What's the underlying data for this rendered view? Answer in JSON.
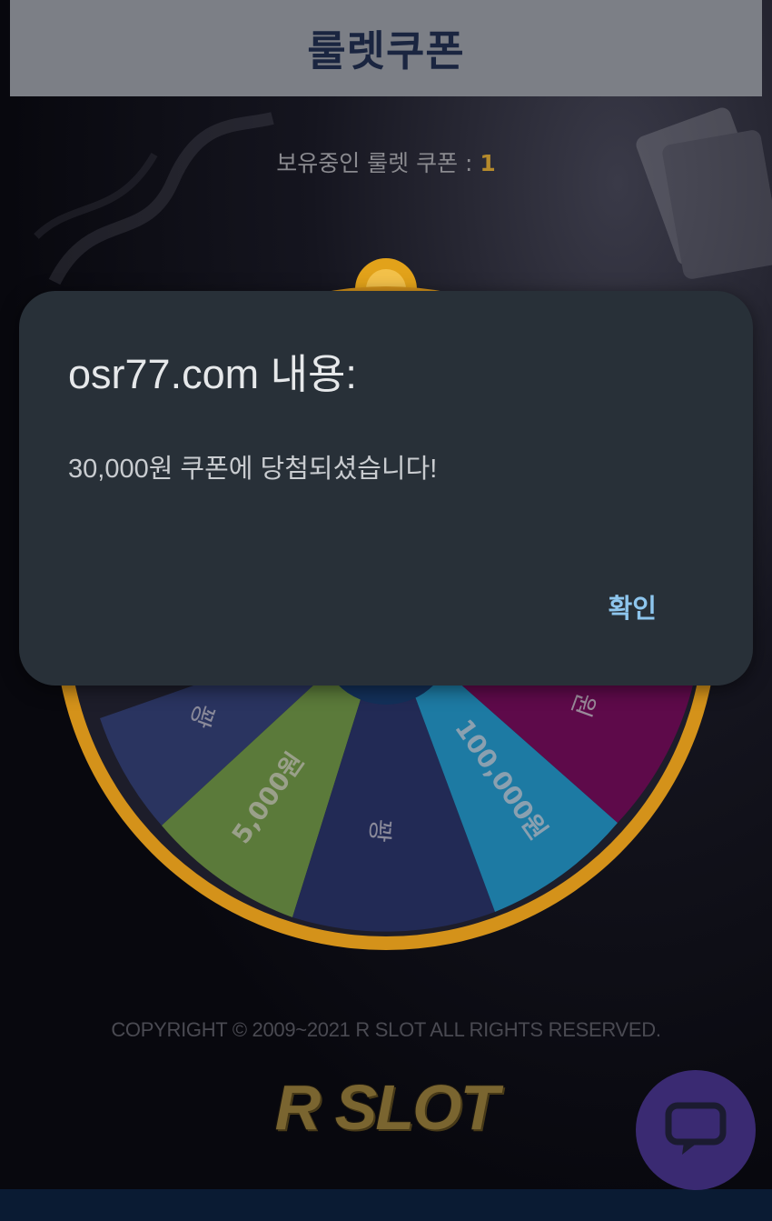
{
  "header": {
    "title": "룰렛쿠폰"
  },
  "coupon": {
    "label": "보유중인 룰렛 쿠폰 : ",
    "count": "1"
  },
  "wheel": {
    "segments": [
      {
        "label": "5,000원",
        "color": "#5b7a3a"
      },
      {
        "label": "꽝",
        "color": "#222a55"
      },
      {
        "label": "100,000원",
        "color": "#1d7aa3"
      },
      {
        "label": "원",
        "color": "#5e0a4a"
      },
      {
        "label": "꽝",
        "color": "#2a3460"
      }
    ],
    "rim_color": "#e2a21a"
  },
  "dialog": {
    "title": "osr77.com 내용:",
    "message": "30,000원 쿠폰에 당첨되셨습니다!",
    "ok_label": "확인"
  },
  "footer": {
    "copyright": "COPYRIGHT © 2009~2021 R SLOT ALL RIGHTS RESERVED.",
    "logo": "R SLOT"
  },
  "chat": {
    "icon": "chat-bubble-icon"
  }
}
